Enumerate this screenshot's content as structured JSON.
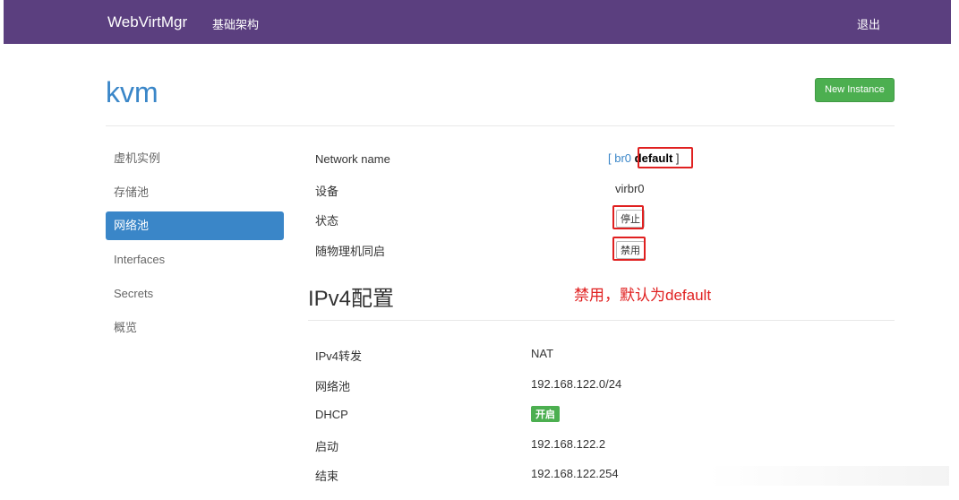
{
  "navbar": {
    "brand": "WebVirtMgr",
    "infra_link": "基础架构",
    "logout": "退出",
    "color": "#5b3f7f"
  },
  "page": {
    "host": "kvm",
    "new_instance": "New Instance"
  },
  "sidebar": {
    "items": [
      {
        "label": "虚机实例"
      },
      {
        "label": "存储池"
      },
      {
        "label": "网络池",
        "active": true
      },
      {
        "label": "Interfaces"
      },
      {
        "label": "Secrets"
      },
      {
        "label": "概览"
      }
    ]
  },
  "network": {
    "name_label": "Network name",
    "name_open": "[ ",
    "name_link": "br0",
    "name_current": "default",
    "name_close": " ]",
    "device_label": "设备",
    "device_value": "virbr0",
    "state_label": "状态",
    "state_button": "停止",
    "autostart_label": "随物理机同启",
    "autostart_button": "禁用"
  },
  "annotation": "禁用，默认为default",
  "ipv4": {
    "title": "IPv4配置",
    "rows": [
      {
        "label": "IPv4转发",
        "value": "NAT"
      },
      {
        "label": "网络池",
        "value": "192.168.122.0/24"
      },
      {
        "label": "DHCP",
        "badge": "开启"
      },
      {
        "label": "启动",
        "value": "192.168.122.2"
      },
      {
        "label": "结束",
        "value": "192.168.122.254"
      }
    ]
  },
  "colors": {
    "accent": "#3a86c8",
    "success": "#4caf50",
    "highlight": "#e02020"
  }
}
